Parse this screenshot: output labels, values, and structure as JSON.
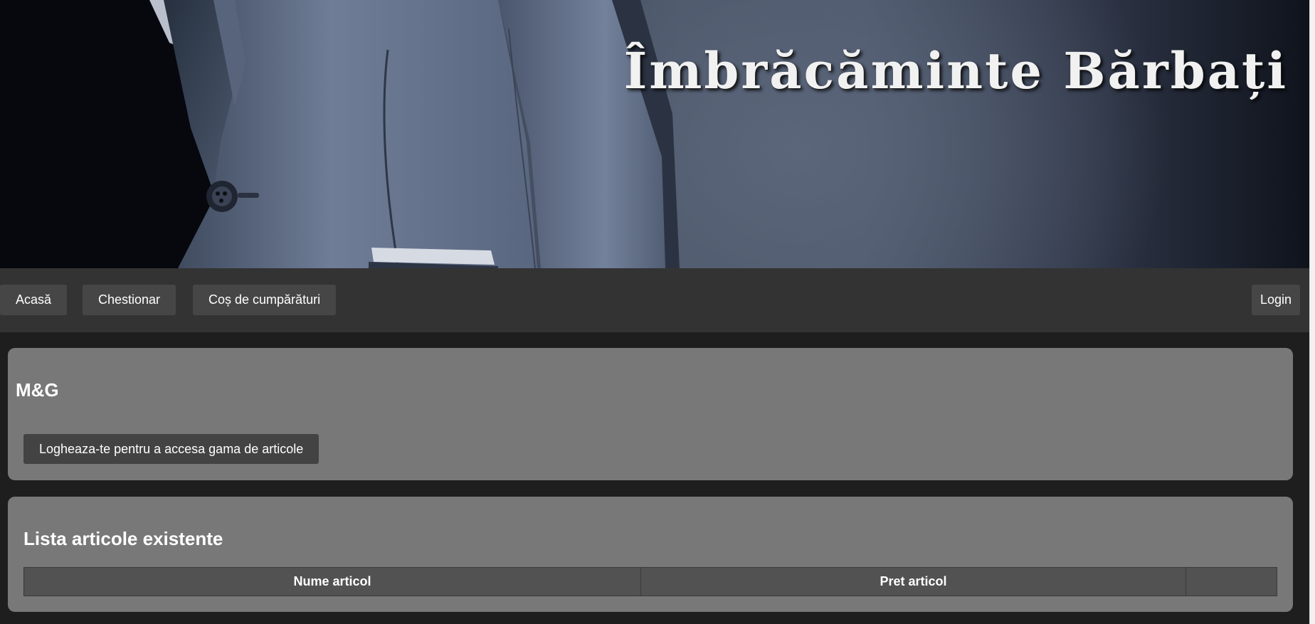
{
  "hero": {
    "title": "Îmbrăcăminte Bărbați"
  },
  "nav": {
    "items": [
      {
        "label": "Acasă"
      },
      {
        "label": "Chestionar"
      },
      {
        "label": "Coș de cumpărături"
      }
    ],
    "login_label": "Login"
  },
  "brand_section": {
    "name": "M&G",
    "login_prompt": "Logheaza-te pentru a accesa gama de articole"
  },
  "articles_section": {
    "title": "Lista articole existente",
    "columns": [
      "Nume articol",
      "Pret articol",
      ""
    ],
    "rows": []
  },
  "colors": {
    "page_background": "#1e1e1e",
    "navbar_background": "#333333",
    "nav_button": "#464646",
    "card_background": "#787878",
    "table_header": "#525252",
    "text": "#ffffff"
  }
}
